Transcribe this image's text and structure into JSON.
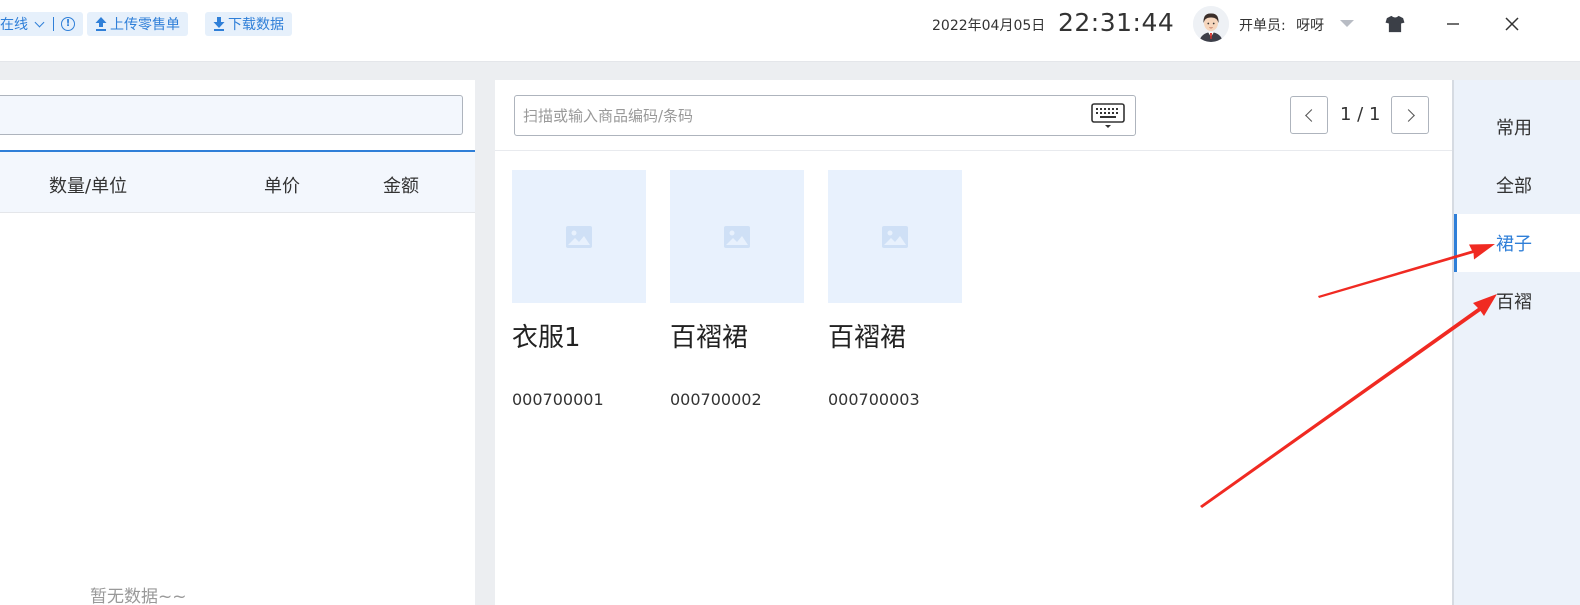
{
  "header": {
    "status_label": "在线",
    "info_glyph": "!",
    "upload_label": "上传零售单",
    "download_label": "下载数据",
    "date": "2022年04月05日",
    "time": "22:31:44",
    "cashier_label": "开单员:",
    "cashier_name": "呀呀"
  },
  "cart": {
    "columns": [
      "数量/单位",
      "单价",
      "金额"
    ],
    "empty_text": "暂无数据~~"
  },
  "products": {
    "search_placeholder": "扫描或输入商品编码/条码",
    "search_value": "",
    "page_indicator": "1 / 1",
    "items": [
      {
        "name": "衣服1",
        "code": "000700001"
      },
      {
        "name": "百褶裙",
        "code": "000700002"
      },
      {
        "name": "百褶裙",
        "code": "000700003"
      }
    ]
  },
  "categories": {
    "items": [
      {
        "label": "常用",
        "active": false
      },
      {
        "label": "全部",
        "active": false
      },
      {
        "label": "裙子",
        "active": true
      },
      {
        "label": "百褶",
        "active": false
      }
    ]
  },
  "colors": {
    "accent": "#2f7fd8",
    "annotation_arrow": "#f02a22"
  },
  "icons": {
    "upload": "upload-icon",
    "download": "download-icon",
    "keyboard": "keyboard-icon",
    "theme": "tshirt-icon",
    "minimize": "minimize-icon",
    "close": "close-icon",
    "placeholder_image": "image-placeholder-icon"
  }
}
